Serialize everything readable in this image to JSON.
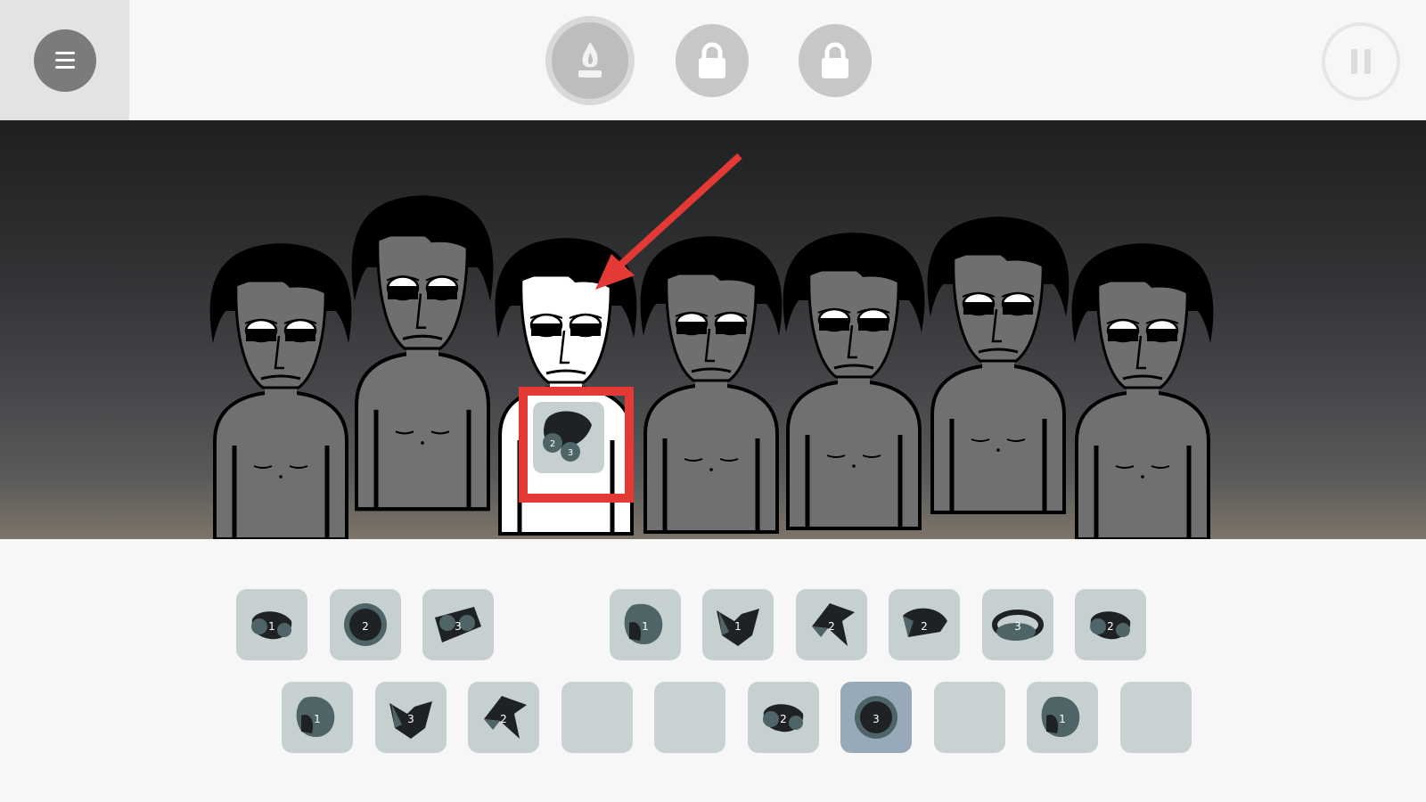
{
  "top_bar": {
    "menu_icon": "hamburger-icon",
    "bonus_buttons": [
      {
        "icon": "candle-flame-icon",
        "state": "available"
      },
      {
        "icon": "lock-icon",
        "state": "locked"
      },
      {
        "icon": "lock-icon",
        "state": "locked"
      }
    ],
    "pause_icon": "pause-icon"
  },
  "stage": {
    "performers": [
      {
        "slot": 1,
        "state": "idle"
      },
      {
        "slot": 2,
        "state": "idle"
      },
      {
        "slot": 3,
        "state": "selected-white",
        "dropped_icon": "voice-icon-3"
      },
      {
        "slot": 4,
        "state": "idle"
      },
      {
        "slot": 5,
        "state": "idle"
      },
      {
        "slot": 6,
        "state": "idle"
      },
      {
        "slot": 7,
        "state": "idle"
      }
    ],
    "annotation": {
      "arrow_color": "#e53935",
      "box_color": "#e53935"
    }
  },
  "palette": {
    "row1": [
      {
        "label": "1",
        "icon": "beat-icon-1",
        "state": "available"
      },
      {
        "label": "2",
        "icon": "beat-icon-2",
        "state": "available"
      },
      {
        "label": "3",
        "icon": "beat-icon-3",
        "state": "available"
      },
      {
        "label": "1",
        "icon": "effect-icon-goggles-1",
        "state": "available"
      },
      {
        "label": "1",
        "icon": "melody-icon-1",
        "state": "available"
      },
      {
        "label": "2",
        "icon": "melody-icon-2",
        "state": "available"
      },
      {
        "label": "2",
        "icon": "melody-icon-3",
        "state": "available"
      },
      {
        "label": "3",
        "icon": "melody-icon-4",
        "state": "available"
      },
      {
        "label": "2",
        "icon": "melody-icon-5",
        "state": "available"
      }
    ],
    "row2": [
      {
        "label": "1",
        "icon": "voice-icon-1",
        "state": "available"
      },
      {
        "label": "3",
        "icon": "voice-icon-2",
        "state": "available"
      },
      {
        "label": "2",
        "icon": "voice-icon-4",
        "state": "available"
      },
      {
        "label": "",
        "icon": "",
        "state": "empty"
      },
      {
        "label": "",
        "icon": "",
        "state": "empty"
      },
      {
        "label": "2",
        "icon": "effect-icon-1",
        "state": "available"
      },
      {
        "label": "3",
        "icon": "effect-icon-goggles-2",
        "state": "active"
      },
      {
        "label": "",
        "icon": "",
        "state": "empty"
      },
      {
        "label": "1",
        "icon": "effect-icon-3",
        "state": "available"
      },
      {
        "label": "",
        "icon": "",
        "state": "empty"
      }
    ]
  },
  "colors": {
    "icon_dark": "#1e2224",
    "icon_teal": "#4f6466",
    "slot_bg": "#c6d0d1",
    "slot_active": "#98a9b9",
    "performer_grey": "#707070",
    "performer_white": "#ffffff"
  }
}
